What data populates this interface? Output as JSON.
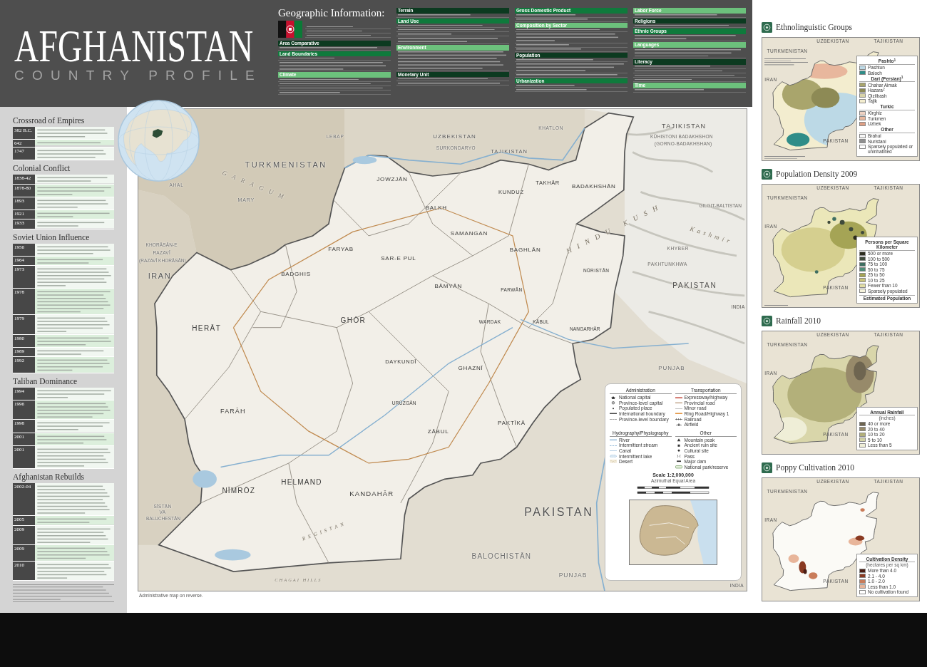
{
  "header": {
    "title": "AFGHANISTAN",
    "subtitle": "COUNTRY PROFILE"
  },
  "geographic_information": {
    "title": "Geographic Information:",
    "columns": [
      {
        "sections": [
          {
            "heading": "Area Comparative",
            "color": "#0c3a20"
          },
          {
            "heading": "Land Boundaries",
            "color": "#0f7a3c"
          },
          {
            "heading": "Climate",
            "color": "#6cc17c"
          }
        ]
      },
      {
        "sections": [
          {
            "heading": "Terrain",
            "color": "#0c3a20"
          },
          {
            "heading": "Land Use",
            "color": "#0f7a3c"
          },
          {
            "heading": "Environment",
            "color": "#6cc17c"
          },
          {
            "heading": "Monetary Unit",
            "color": "#0c3a20"
          }
        ]
      },
      {
        "sections": [
          {
            "heading": "Gross Domestic Product",
            "color": "#0f7a3c"
          },
          {
            "heading": "Composition by Sector",
            "color": "#6cc17c"
          },
          {
            "heading": "Population",
            "color": "#0c3a20"
          },
          {
            "heading": "Urbanization",
            "color": "#0f7a3c"
          }
        ]
      },
      {
        "sections": [
          {
            "heading": "Labor Force",
            "color": "#6cc17c"
          },
          {
            "heading": "Religions",
            "color": "#0c3a20"
          },
          {
            "heading": "Ethnic Groups",
            "color": "#0f7a3c"
          },
          {
            "heading": "Languages",
            "color": "#6cc17c"
          },
          {
            "heading": "Literacy",
            "color": "#0c3a20"
          },
          {
            "heading": "Time",
            "color": "#6cc17c"
          }
        ]
      }
    ]
  },
  "timeline": {
    "sections": [
      {
        "title": "Crossroad of Empires",
        "events": [
          {
            "year": "382 B.C."
          },
          {
            "year": "642"
          },
          {
            "year": "1747"
          }
        ]
      },
      {
        "title": "Colonial Conflict",
        "events": [
          {
            "year": "1838-42"
          },
          {
            "year": "1878-80"
          },
          {
            "year": "1893"
          },
          {
            "year": "1921"
          },
          {
            "year": "1933"
          }
        ]
      },
      {
        "title": "Soviet Union Influence",
        "events": [
          {
            "year": "1956"
          },
          {
            "year": "1964"
          },
          {
            "year": "1973"
          },
          {
            "year": "1978"
          },
          {
            "year": "1979"
          },
          {
            "year": "1980"
          },
          {
            "year": "1989"
          },
          {
            "year": "1992"
          }
        ]
      },
      {
        "title": "Taliban Dominance",
        "events": [
          {
            "year": "1994"
          },
          {
            "year": "1996"
          },
          {
            "year": "1998"
          },
          {
            "year": "2001"
          },
          {
            "year": "2001"
          }
        ]
      },
      {
        "title": "Afghanistan Rebuilds",
        "events": [
          {
            "year": "2002-04"
          },
          {
            "year": "2005"
          },
          {
            "year": "2009"
          },
          {
            "year": "2009"
          },
          {
            "year": "2010"
          }
        ]
      }
    ]
  },
  "map": {
    "labels": [
      {
        "text": "TURKMENISTAN",
        "kind": "country"
      },
      {
        "text": "LEBAP",
        "kind": "region"
      },
      {
        "text": "UZBEKISTAN",
        "kind": "country"
      },
      {
        "text": "SURKONDARYO",
        "kind": "region"
      },
      {
        "text": "KHATLON",
        "kind": "region"
      },
      {
        "text": "TAJIKISTAN",
        "kind": "country"
      },
      {
        "text": "TAJIKISTAN",
        "kind": "country"
      },
      {
        "text": "KŪHISTONI BADAKHSHON",
        "kind": "region"
      },
      {
        "text": "(GORNO-BADAKHSHAN)",
        "kind": "region"
      },
      {
        "text": "GARAGUM",
        "kind": "physical"
      },
      {
        "text": "AHAL",
        "kind": "region"
      },
      {
        "text": "MARY",
        "kind": "region"
      },
      {
        "text": "JOWZJĀN",
        "kind": "province"
      },
      {
        "text": "BALKH",
        "kind": "province"
      },
      {
        "text": "KUNDUZ",
        "kind": "province"
      },
      {
        "text": "TAKHĀR",
        "kind": "province"
      },
      {
        "text": "BADAKHSHĀN",
        "kind": "province"
      },
      {
        "text": "SAMANGAN",
        "kind": "province"
      },
      {
        "text": "BAGHLĀN",
        "kind": "province"
      },
      {
        "text": "HINDU KUSH",
        "kind": "physical"
      },
      {
        "text": "GILGIT-BALTISTAN",
        "kind": "region"
      },
      {
        "text": "Kashmir",
        "kind": "physical"
      },
      {
        "text": "FARYAB",
        "kind": "province"
      },
      {
        "text": "SAR-E PUL",
        "kind": "province"
      },
      {
        "text": "KHORĀSĀN-E",
        "kind": "region"
      },
      {
        "text": "RAZAVĪ",
        "kind": "region"
      },
      {
        "text": "(RAZAVĪ KHORĀSĀN)",
        "kind": "region"
      },
      {
        "text": "IRAN",
        "kind": "country"
      },
      {
        "text": "BADGHIS",
        "kind": "province"
      },
      {
        "text": "KHYBER",
        "kind": "region"
      },
      {
        "text": "PAKHTUNKHWA",
        "kind": "region"
      },
      {
        "text": "NŪRISTĀN",
        "kind": "province"
      },
      {
        "text": "PAKISTAN",
        "kind": "country"
      },
      {
        "text": "BĀMYĀN",
        "kind": "province"
      },
      {
        "text": "PARWĀN",
        "kind": "province"
      },
      {
        "text": "HERĀT",
        "kind": "province"
      },
      {
        "text": "GHŌR",
        "kind": "province"
      },
      {
        "text": "WARDAK",
        "kind": "province"
      },
      {
        "text": "KĀBUL",
        "kind": "province"
      },
      {
        "text": "NANGARHĀR",
        "kind": "province"
      },
      {
        "text": "DAYKUNDĪ",
        "kind": "province"
      },
      {
        "text": "GHAZNĪ",
        "kind": "province"
      },
      {
        "text": "PUNJAB",
        "kind": "region"
      },
      {
        "text": "URŪZGĀN",
        "kind": "province"
      },
      {
        "text": "FARĀH",
        "kind": "province"
      },
      {
        "text": "PAKTĪKĀ",
        "kind": "province"
      },
      {
        "text": "ZĀBUL",
        "kind": "province"
      },
      {
        "text": "NĪMRŌZ",
        "kind": "province"
      },
      {
        "text": "HELMAND",
        "kind": "province"
      },
      {
        "text": "KANDAHĀR",
        "kind": "province"
      },
      {
        "text": "SĪSTĀN",
        "kind": "region"
      },
      {
        "text": "VA",
        "kind": "region"
      },
      {
        "text": "BALUCHESTĀN",
        "kind": "region"
      },
      {
        "text": "REGISTAN",
        "kind": "physical"
      },
      {
        "text": "PAKISTAN",
        "kind": "country"
      },
      {
        "text": "BALOCHISTĀN",
        "kind": "region"
      },
      {
        "text": "CHAGAI HILLS",
        "kind": "physical"
      },
      {
        "text": "PUNJAB",
        "kind": "region"
      },
      {
        "text": "INDIA",
        "kind": "country"
      },
      {
        "text": "INDIA",
        "kind": "country"
      }
    ],
    "legend": {
      "groups": [
        {
          "heading": "Administration",
          "items": [
            {
              "label": "National capital",
              "kind": "capital"
            },
            {
              "label": "Province-level capital",
              "kind": "provincecapital"
            },
            {
              "label": "Populated place",
              "kind": "place"
            },
            {
              "label": "International boundary",
              "kind": "boundary"
            },
            {
              "label": "Province-level boundary",
              "kind": "provinceboundary"
            }
          ]
        },
        {
          "heading": "Transportation",
          "items": [
            {
              "label": "Expressway/highway",
              "kind": "highway"
            },
            {
              "label": "Provincial road",
              "kind": "provincialroad"
            },
            {
              "label": "Minor road",
              "kind": "minorroad"
            },
            {
              "label": "Ring Road/Highway 1",
              "kind": "ringroad"
            },
            {
              "label": "Railroad",
              "kind": "railroad"
            },
            {
              "label": "Airfield",
              "kind": "airfield"
            }
          ]
        },
        {
          "heading": "Hydrography/Physiography",
          "items": [
            {
              "label": "River",
              "kind": "river"
            },
            {
              "label": "Intermittent stream",
              "kind": "stream"
            },
            {
              "label": "Canal",
              "kind": "canal"
            },
            {
              "label": "Intermittent lake",
              "kind": "lake"
            },
            {
              "label": "Desert",
              "kind": "desert"
            }
          ]
        },
        {
          "heading": "Other",
          "items": [
            {
              "label": "Mountain peak",
              "kind": "peak"
            },
            {
              "label": "Ancient ruin site",
              "kind": "ruin"
            },
            {
              "label": "Cultural site",
              "kind": "culturalsite"
            },
            {
              "label": "Pass",
              "kind": "pass"
            },
            {
              "label": "Major dam",
              "kind": "dam"
            },
            {
              "label": "National park/reserve",
              "kind": "park"
            }
          ]
        }
      ],
      "scale": "Scale 1:2,000,000",
      "projection": "Azimuthal Equal Area"
    },
    "footnote": "Administrative map on reverse."
  },
  "thematic_maps": [
    {
      "title": "Ethnolinguistic Groups",
      "kind": "ethnic",
      "labels": [
        "UZBEKISTAN",
        "TAJIKISTAN",
        "TURKMENISTAN",
        "IRAN",
        "PAKISTAN"
      ],
      "legend": [
        {
          "heading": "Pashto$^{1}$",
          "items": [
            {
              "label": "Pashtun",
              "color": "#bcd9e6"
            },
            {
              "label": "Baloch",
              "color": "#2f8d88"
            }
          ]
        },
        {
          "heading": "Dari (Persian)$^{1}$",
          "items": [
            {
              "label": "Chahar Aimak",
              "color": "#a9a56c"
            },
            {
              "label": "Hazara$^{2}$",
              "color": "#8d8a55"
            },
            {
              "label": "Qizilbash",
              "color": "#d8d3a8"
            },
            {
              "label": "Tajik",
              "color": "#f3edcf"
            }
          ]
        },
        {
          "heading": "Turkic",
          "items": [
            {
              "label": "Kirghiz",
              "color": "#efd2c2"
            },
            {
              "label": "Turkmen",
              "color": "#e8b79d"
            },
            {
              "label": "Uzbek",
              "color": "#dd9f85"
            }
          ]
        },
        {
          "heading": "Other",
          "items": [
            {
              "label": "Brahui",
              "color": "#f7f7f7"
            },
            {
              "label": "Nuristani",
              "color": "#8f8f8f"
            },
            {
              "label": "Sparsely populated or uninhabited",
              "color": "#ffffff"
            }
          ]
        }
      ]
    },
    {
      "title": "Population Density 2009",
      "kind": "density",
      "labels": [
        "UZBEKISTAN",
        "TAJIKISTAN",
        "TURKMENISTAN",
        "IRAN",
        "PAKISTAN"
      ],
      "legend": [
        {
          "heading": "Persons per Square Kilometer",
          "items": [
            {
              "label": "500 or more",
              "color": "#2c2c1e"
            },
            {
              "label": "100 to 500",
              "color": "#3f4a3b"
            },
            {
              "label": "75 to 100",
              "color": "#3e6e61"
            },
            {
              "label": "50 to 75",
              "color": "#4e8c78"
            },
            {
              "label": "25 to 50",
              "color": "#a5a455"
            },
            {
              "label": "10 to 25",
              "color": "#c8c27a"
            },
            {
              "label": "Fewer than 10",
              "color": "#e2dea6"
            },
            {
              "label": "Sparsely populated",
              "color": "#f6f3dc"
            }
          ]
        }
      ],
      "legend_footer": "Estimated Population"
    },
    {
      "title": "Rainfall 2010",
      "kind": "rainfall",
      "labels": [
        "UZBEKISTAN",
        "TAJIKISTAN",
        "TURKMENISTAN",
        "IRAN",
        "PAKISTAN"
      ],
      "legend": [
        {
          "heading": "Annual Rainfall",
          "subheading": "(inches)",
          "items": [
            {
              "label": "40 or more",
              "color": "#6e6550"
            },
            {
              "label": "20 to 40",
              "color": "#978a6a"
            },
            {
              "label": "10 to 20",
              "color": "#b3b07a"
            },
            {
              "label": "5 to 10",
              "color": "#d3d3a5"
            },
            {
              "label": "Less than 5",
              "color": "#efeed7"
            }
          ]
        }
      ]
    },
    {
      "title": "Poppy Cultivation 2010",
      "kind": "cultivation",
      "labels": [
        "UZBEKISTAN",
        "TAJIKISTAN",
        "TURKMENISTAN",
        "IRAN",
        "PAKISTAN"
      ],
      "legend": [
        {
          "heading": "Cultivation Density",
          "subheading": "(hectares per sq km)",
          "items": [
            {
              "label": "More than 4.0",
              "color": "#4a1e14"
            },
            {
              "label": "2.1 - 4.0",
              "color": "#8a3a22"
            },
            {
              "label": "1.0 - 2.0",
              "color": "#c97c5a"
            },
            {
              "label": "Less than 1.0",
              "color": "#e8b59a"
            },
            {
              "label": "No cultivation found",
              "color": "#ffffff"
            }
          ]
        }
      ]
    }
  ]
}
